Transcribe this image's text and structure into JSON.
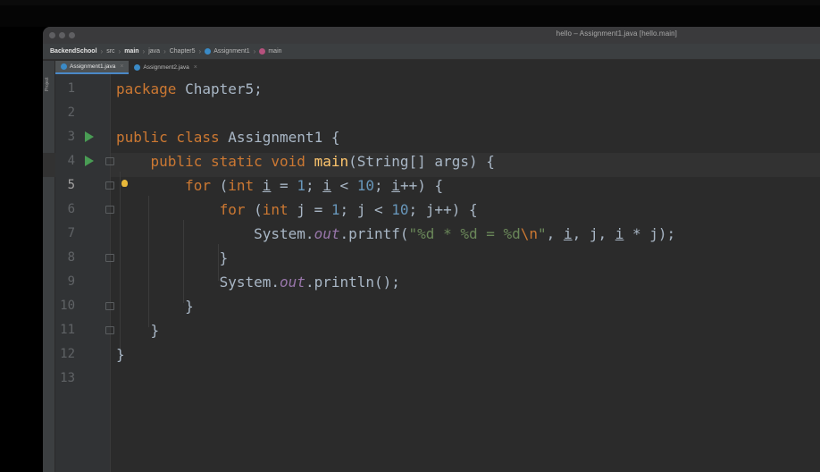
{
  "window": {
    "title": "hello – Assignment1.java [hello.main]"
  },
  "breadcrumbs": [
    {
      "label": "BackendSchool",
      "bold": true
    },
    {
      "label": "src",
      "bold": false
    },
    {
      "label": "main",
      "bold": true
    },
    {
      "label": "java",
      "bold": false
    },
    {
      "label": "Chapter5",
      "bold": false
    },
    {
      "label": "Assignment1",
      "bold": false,
      "icon": "class-icon"
    },
    {
      "label": "main",
      "bold": false,
      "icon": "method-icon"
    }
  ],
  "tool_window": {
    "label": "Project"
  },
  "tabs": [
    {
      "label": "Assignment1.java",
      "active": true,
      "icon": "class-icon"
    },
    {
      "label": "Assignment2.java",
      "active": false,
      "icon": "class-icon"
    }
  ],
  "colors": {
    "keyword": "#cc7832",
    "number": "#6897bb",
    "string": "#6a8759",
    "method": "#ffc66d",
    "static_field": "#9876aa",
    "run_marker": "#499c54"
  },
  "editor": {
    "current_line": 5,
    "line_numbers": [
      "1",
      "2",
      "3",
      "4",
      "5",
      "6",
      "7",
      "8",
      "9",
      "10",
      "11",
      "12",
      "13"
    ],
    "lines": [
      "package Chapter5;",
      "",
      "public class Assignment1 {",
      "    public static void main(String[] args) {",
      "        for (int i = 1; i < 10; i++) {",
      "            for (int j = 1; j < 10; j++) {",
      "                System.out.printf(\"%d * %d = %d\\n\", i, j, i * j);",
      "            }",
      "            System.out.println();",
      "        }",
      "    }",
      "}",
      ""
    ]
  }
}
